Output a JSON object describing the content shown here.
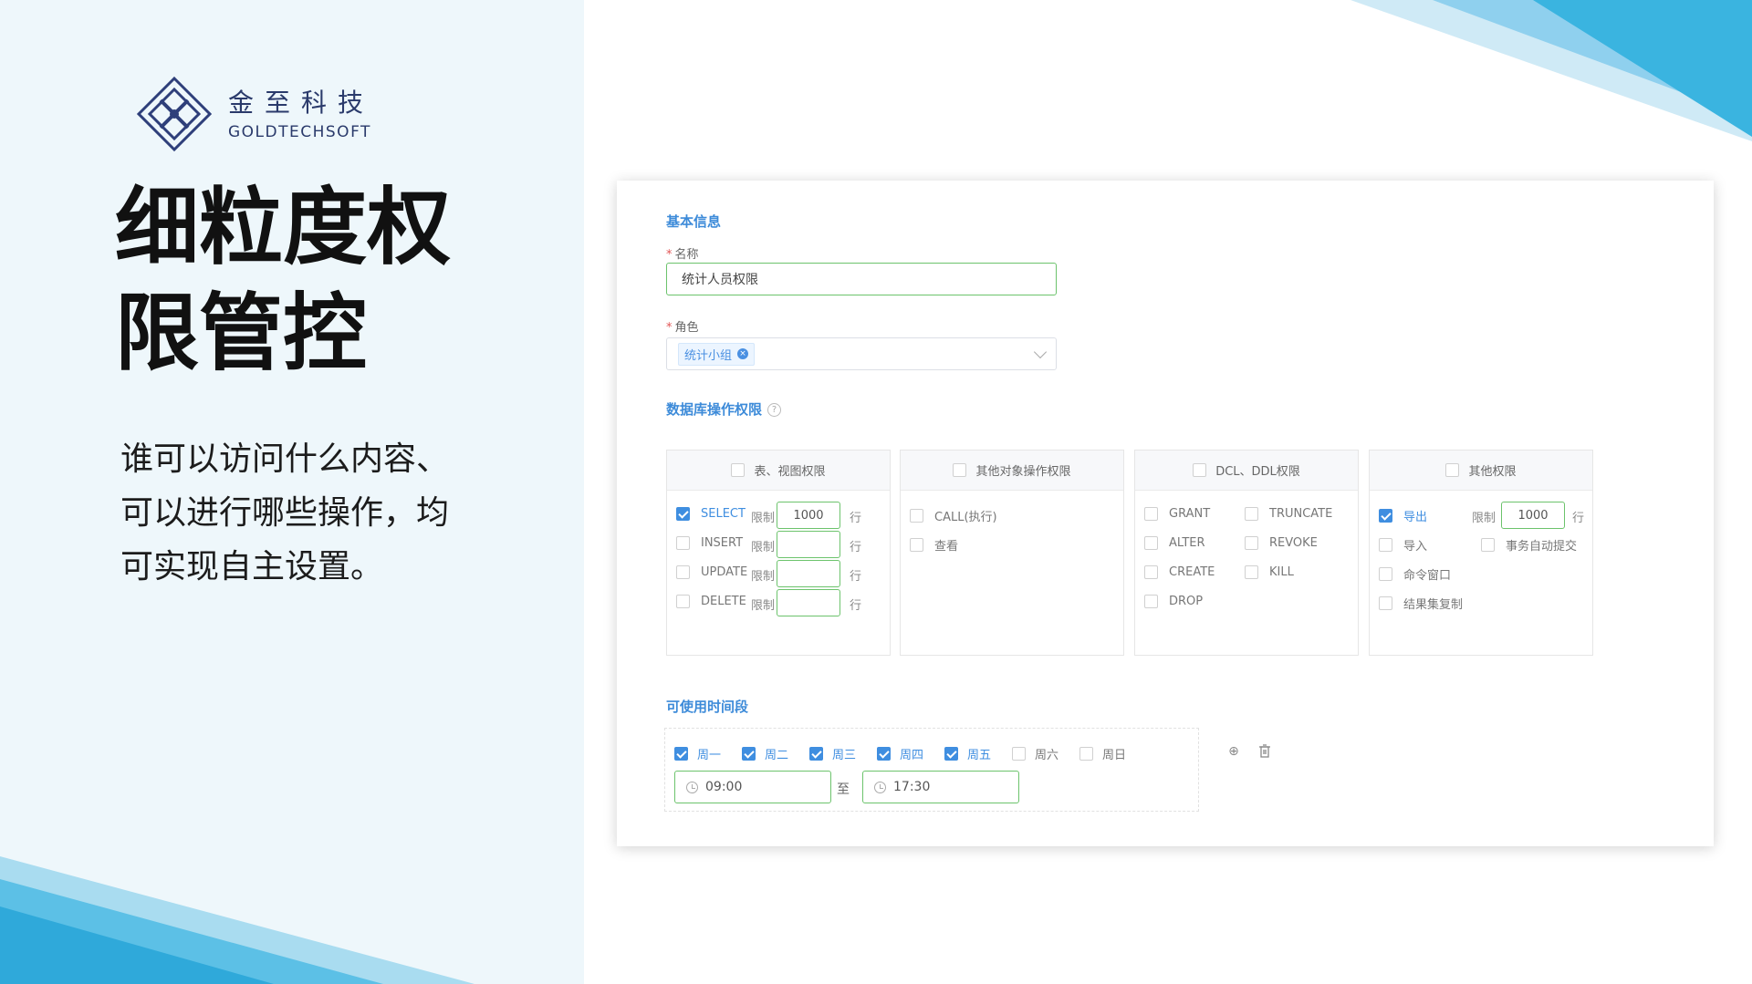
{
  "brand": {
    "name_cn": "金至科技",
    "name_en": "GOLDTECHSOFT",
    "colors": {
      "accent": "#3f8ee0",
      "deco": "#3ab4e0",
      "title": "#111111"
    }
  },
  "headline": {
    "line1": "细粒度权",
    "line2": "限管控"
  },
  "subtext": {
    "line1": "谁可以访问什么内容、",
    "line2": "可以进行哪些操作，均",
    "line3": "可实现自主设置。"
  },
  "form": {
    "basic_title": "基本信息",
    "name_label": "名称",
    "name_value": "统计人员权限",
    "role_label": "角色",
    "role_tag": "统计小组",
    "db_perm_title": "数据库操作权限",
    "limit_label": "限制",
    "row_unit": "行",
    "groups": {
      "table": {
        "title": "表、视图权限",
        "items": [
          {
            "label": "SELECT",
            "checked": true,
            "limit": "1000"
          },
          {
            "label": "INSERT",
            "checked": false,
            "limit": ""
          },
          {
            "label": "UPDATE",
            "checked": false,
            "limit": ""
          },
          {
            "label": "DELETE",
            "checked": false,
            "limit": ""
          }
        ]
      },
      "other_obj": {
        "title": "其他对象操作权限",
        "items": [
          {
            "label": "CALL(执行)"
          },
          {
            "label": "查看"
          }
        ]
      },
      "dcl": {
        "title": "DCL、DDL权限",
        "items": [
          {
            "label": "GRANT"
          },
          {
            "label": "TRUNCATE"
          },
          {
            "label": "ALTER"
          },
          {
            "label": "REVOKE"
          },
          {
            "label": "CREATE"
          },
          {
            "label": "KILL"
          },
          {
            "label": "DROP"
          }
        ]
      },
      "other": {
        "title": "其他权限",
        "items": [
          {
            "label": "导出",
            "checked": true,
            "limit": "1000"
          },
          {
            "label": "导入"
          },
          {
            "label": "事务自动提交"
          },
          {
            "label": "命令窗口"
          },
          {
            "label": "结果集复制"
          }
        ]
      }
    },
    "time_title": "可使用时间段",
    "days": [
      {
        "label": "周一",
        "checked": true
      },
      {
        "label": "周二",
        "checked": true
      },
      {
        "label": "周三",
        "checked": true
      },
      {
        "label": "周四",
        "checked": true
      },
      {
        "label": "周五",
        "checked": true
      },
      {
        "label": "周六",
        "checked": false
      },
      {
        "label": "周日",
        "checked": false
      }
    ],
    "start_time": "09:00",
    "to_label": "至",
    "end_time": "17:30"
  }
}
